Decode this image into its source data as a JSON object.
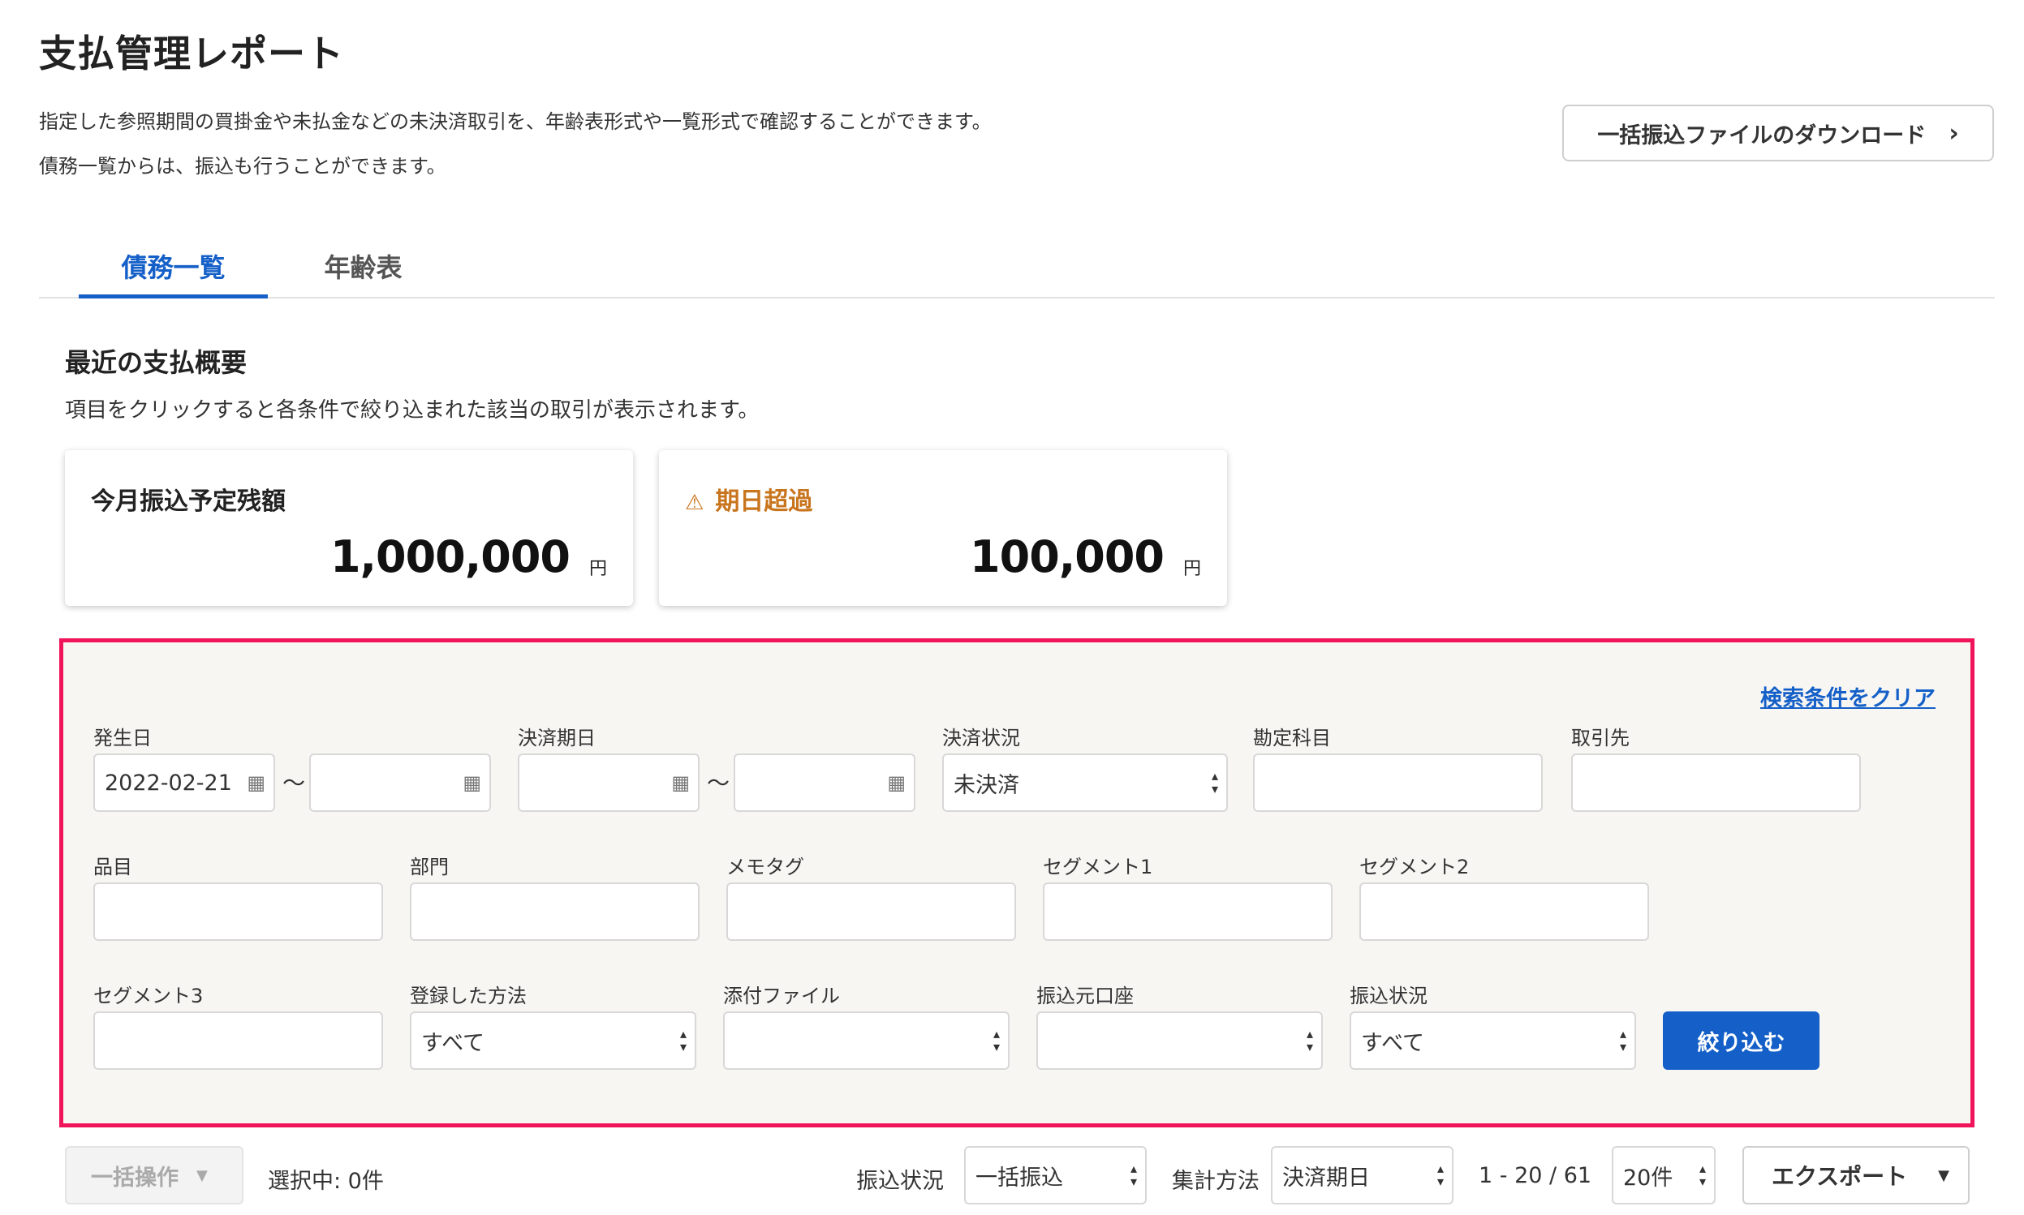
{
  "header": {
    "title": "支払管理レポート",
    "description_line1": "指定した参照期間の買掛金や未払金などの未決済取引を、年齢表形式や一覧形式で確認することができます。",
    "description_line2": "債務一覧からは、振込も行うことができます。",
    "download_button": "一括振込ファイルのダウンロード"
  },
  "tabs": [
    {
      "label": "債務一覧",
      "active": true
    },
    {
      "label": "年齢表",
      "active": false
    }
  ],
  "summary": {
    "heading": "最近の支払概要",
    "subtext": "項目をクリックすると各条件で絞り込まれた該当の取引が表示されます。",
    "cards": [
      {
        "label": "今月振込予定残額",
        "amount": "1,000,000",
        "unit": "円",
        "warning": false
      },
      {
        "label": "期日超過",
        "amount": "100,000",
        "unit": "円",
        "warning": true
      }
    ]
  },
  "filters": {
    "clear_link": "検索条件をクリア",
    "occurrence_date": {
      "label": "発生日",
      "from": "2022-02-21",
      "to": ""
    },
    "due_date": {
      "label": "決済期日",
      "from": "",
      "to": ""
    },
    "settlement_status": {
      "label": "決済状況",
      "value": "未決済"
    },
    "account_item": {
      "label": "勘定科目",
      "value": ""
    },
    "partner": {
      "label": "取引先",
      "value": ""
    },
    "item": {
      "label": "品目",
      "value": ""
    },
    "department": {
      "label": "部門",
      "value": ""
    },
    "memo_tag": {
      "label": "メモタグ",
      "value": ""
    },
    "segment1": {
      "label": "セグメント1",
      "value": ""
    },
    "segment2": {
      "label": "セグメント2",
      "value": ""
    },
    "segment3": {
      "label": "セグメント3",
      "value": ""
    },
    "registration_method": {
      "label": "登録した方法",
      "value": "すべて"
    },
    "attachment": {
      "label": "添付ファイル",
      "value": ""
    },
    "source_account": {
      "label": "振込元口座",
      "value": ""
    },
    "transfer_status": {
      "label": "振込状況",
      "value": "すべて"
    },
    "apply_button": "絞り込む",
    "tilde": "〜"
  },
  "toolbar": {
    "bulk_action": "一括操作",
    "selected": "選択中: 0件",
    "transfer_status_label": "振込状況",
    "transfer_status_value": "一括振込",
    "aggregation_label": "集計方法",
    "aggregation_value": "決済期日",
    "pagination": "1 - 20 / 61",
    "per_page": "20件",
    "export": "エクスポート"
  },
  "colors": {
    "accent": "#1560c8",
    "highlight_border": "#f0145a",
    "warning": "#c8751e"
  }
}
